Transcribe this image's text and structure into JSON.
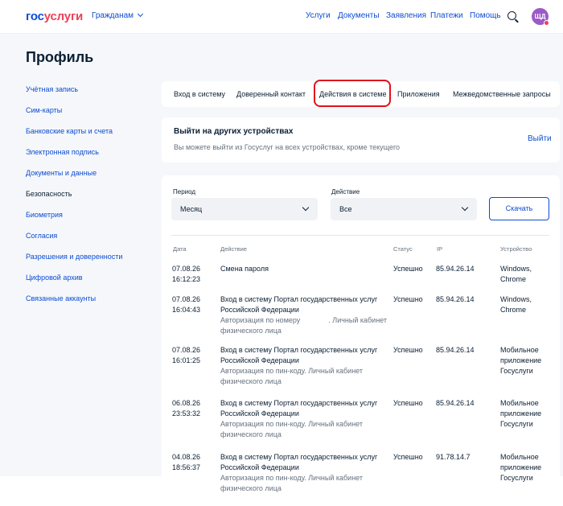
{
  "header": {
    "logo_part1": "гос",
    "logo_part2": "услуги",
    "audience": "Гражданам",
    "nav": [
      "Услуги",
      "Документы",
      "Заявления",
      "Платежи",
      "Помощь"
    ],
    "avatar_initials": "ЩД"
  },
  "page_title": "Профиль",
  "sidebar": {
    "items": [
      {
        "label": "Учётная запись",
        "active": false
      },
      {
        "label": "Сим-карты",
        "active": false
      },
      {
        "label": "Банковские карты и счета",
        "active": false
      },
      {
        "label": "Электронная подпись",
        "active": false
      },
      {
        "label": "Документы и данные",
        "active": false
      },
      {
        "label": "Безопасность",
        "active": true
      },
      {
        "label": "Биометрия",
        "active": false
      },
      {
        "label": "Согласия",
        "active": false
      },
      {
        "label": "Разрешения и доверенности",
        "active": false
      },
      {
        "label": "Цифровой архив",
        "active": false
      },
      {
        "label": "Связанные аккаунты",
        "active": false
      }
    ]
  },
  "tabs": [
    {
      "label": "Вход в систему"
    },
    {
      "label": "Доверенный контакт"
    },
    {
      "label": "Действия в системе"
    },
    {
      "label": "Приложения"
    },
    {
      "label": "Межведомственные запросы"
    }
  ],
  "logout": {
    "title": "Выйти на других устройствах",
    "description": "Вы можете выйти из Госуслуг на всех устройствах, кроме текущего",
    "link": "Выйти"
  },
  "filters": {
    "period_label": "Период",
    "period_value": "Месяц",
    "action_label": "Действие",
    "action_value": "Все",
    "download_label": "Скачать"
  },
  "table": {
    "headers": [
      "Дата",
      "Действие",
      "Статус",
      "IP",
      "Устройство"
    ],
    "rows": [
      {
        "date": "07.08.26",
        "time": "16:12:23",
        "action1": "Смена пароля",
        "action2": "",
        "detail1": "",
        "detail2": "",
        "status": "Успешно",
        "ip": "85.94.26.14",
        "device1": "Windows,",
        "device2": "Chrome",
        "device3": ""
      },
      {
        "date": "07.08.26",
        "time": "16:04:43",
        "action1": "Вход в систему Портал государственных услуг",
        "action2": "Российской Федерации",
        "detail1": "Авторизация по номеру              . Личный кабинет",
        "detail2": "физического лица",
        "status": "Успешно",
        "ip": "85.94.26.14",
        "device1": "Windows,",
        "device2": "Chrome",
        "device3": ""
      },
      {
        "date": "07.08.26",
        "time": "16:01:25",
        "action1": "Вход в систему Портал государственных услуг",
        "action2": "Российской Федерации",
        "detail1": "Авторизация по пин-коду. Личный кабинет",
        "detail2": "физического лица",
        "status": "Успешно",
        "ip": "85.94.26.14",
        "device1": "Мобильное",
        "device2": "приложение",
        "device3": "Госуслуги"
      },
      {
        "date": "06.08.26",
        "time": "23:53:32",
        "action1": "Вход в систему Портал государственных услуг",
        "action2": "Российской Федерации",
        "detail1": "Авторизация по пин-коду. Личный кабинет",
        "detail2": "физического лица",
        "status": "Успешно",
        "ip": "85.94.26.14",
        "device1": "Мобильное",
        "device2": "приложение",
        "device3": "Госуслуги"
      },
      {
        "date": "04.08.26",
        "time": "18:56:37",
        "action1": "Вход в систему Портал государственных услуг",
        "action2": "Российской Федерации",
        "detail1": "Авторизация по пин-коду. Личный кабинет",
        "detail2": "физического лица",
        "status": "Успешно",
        "ip": "91.78.14.7",
        "device1": "Мобильное",
        "device2": "приложение",
        "device3": "Госуслуги"
      }
    ]
  },
  "colors": {
    "accent": "#0d4cd3",
    "brand_red": "#ee3f58",
    "highlight": "#e0121e"
  }
}
